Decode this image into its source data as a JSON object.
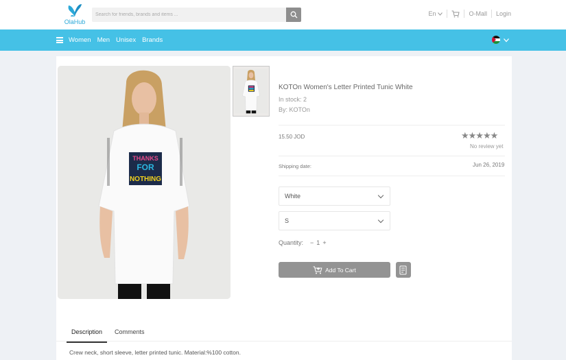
{
  "header": {
    "logo_text": "OlaHub",
    "search_placeholder": "Search for friends, brands and items ...",
    "language": "En",
    "mall_label": "O-Mall",
    "login_label": "Login"
  },
  "navbar": {
    "items": [
      "Women",
      "Men",
      "Unisex",
      "Brands"
    ]
  },
  "product": {
    "title": "KOTOn Women's Letter Printed Tunic White",
    "stock": "In stock: 2",
    "brand": "By: KOTOn",
    "price": "15.50 JOD",
    "stars": "★★★★★",
    "review_text": "No review yet",
    "shipping_label": "Shipping date:",
    "shipping_date": "Jun 26, 2019",
    "color_selected": "White",
    "size_selected": "S",
    "quantity_label": "Quantity:",
    "quantity_minus": "−",
    "quantity_value": "1",
    "quantity_plus": "+",
    "add_to_cart": "Add To Cart",
    "shirt_print": [
      "THANKS",
      "FOR",
      "NOTHING"
    ]
  },
  "tabs": {
    "description": "Description",
    "comments": "Comments",
    "description_text": "Crew neck, short sleeve, letter printed tunic. Material:%100 cotton."
  },
  "colors": {
    "accent": "#45c1e6",
    "button": "#939393"
  }
}
